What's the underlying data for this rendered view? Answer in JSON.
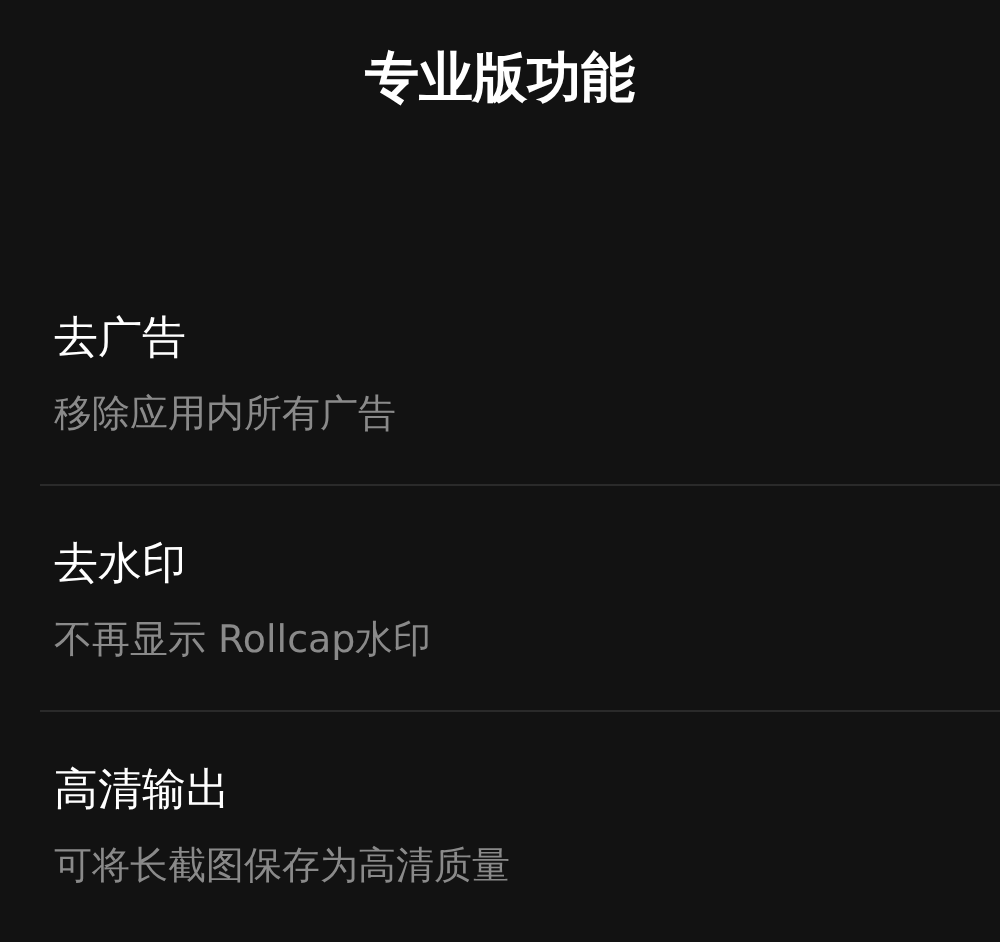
{
  "title": "专业版功能",
  "features": [
    {
      "name": "去广告",
      "description": "移除应用内所有广告"
    },
    {
      "name": "去水印",
      "description": "不再显示 Rollcap水印"
    },
    {
      "name": "高清输出",
      "description": "可将长截图保存为高清质量"
    }
  ]
}
